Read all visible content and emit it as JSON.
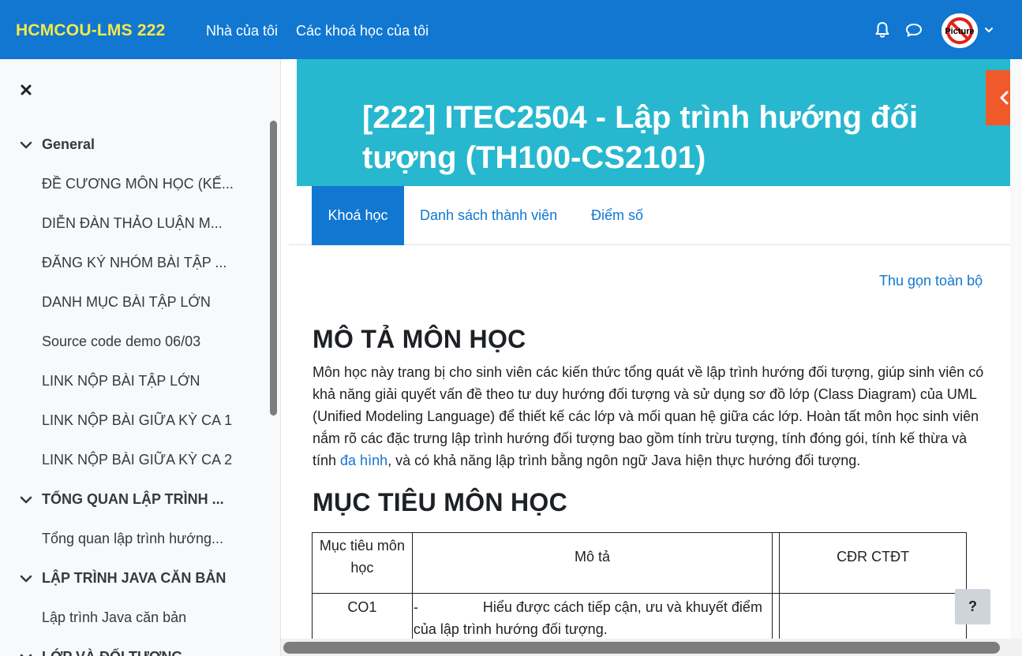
{
  "navbar": {
    "brand": "HCMCOU-LMS 222",
    "links": [
      "Nhà của tôi",
      "Các khoá học của tôi"
    ],
    "avatar_text": "Picture"
  },
  "drawer": {
    "sections": [
      {
        "title": "General",
        "items": [
          "ĐỀ CƯƠNG MÔN HỌC (KẾ...",
          "DIỄN ĐÀN THẢO LUẬN M...",
          "ĐĂNG KÝ NHÓM BÀI TẬP ...",
          "DANH MỤC BÀI TẬP LỚN",
          "Source code demo 06/03",
          "LINK NỘP BÀI TẬP LỚN",
          "LINK NỘP BÀI GIỮA KỲ CA 1",
          "LINK NỘP BÀI GIỮA KỲ CA 2"
        ]
      },
      {
        "title": "TỔNG QUAN LẬP TRÌNH ...",
        "items": [
          "Tổng quan lập trình hướng..."
        ]
      },
      {
        "title": "LẬP TRÌNH JAVA CĂN BẢN",
        "items": [
          "Lập trình Java căn bản"
        ]
      },
      {
        "title": "LỚP VÀ ĐỐI TƯỢNG",
        "items": []
      }
    ]
  },
  "course": {
    "title": "[222] ITEC2504 - Lập trình hướng đối tượng (TH100-CS2101)"
  },
  "tabs": [
    "Khoá học",
    "Danh sách thành viên",
    "Điểm số"
  ],
  "collapse_all": "Thu gọn toàn bộ",
  "description": {
    "heading": "MÔ TẢ MÔN HỌC",
    "text_before_link": "Môn học này trang bị cho sinh viên các kiến thức tổng quát về lập trình hướng đối tượng, giúp sinh viên có khả năng giải quyết vấn đề theo tư duy hướng đối tượng và sử dụng sơ đồ lớp (Class Diagram) của UML (Unified Modeling Language) để thiết kế các lớp và mối quan hệ giữa các lớp.  Hoàn tất môn học sinh viên nắm rõ các đặc trưng lập trình hướng đối tượng bao gồm tính trừu tượng, tính đóng gói, tính kế thừa và tính ",
    "link": "đa hình",
    "text_after_link": ", và có khả năng lập trình bằng ngôn ngữ Java hiện thực hướng đối tượng."
  },
  "goals": {
    "heading": "MỤC TIÊU MÔN HỌC",
    "table": {
      "headers": [
        "Mục tiêu môn học",
        "Mô tả",
        "",
        "CĐR CTĐT"
      ],
      "rows": [
        {
          "code": "CO1",
          "dash": "-",
          "desc": "Hiểu được cách tiếp cận, ưu và khuyết điểm của lập trình hướng đối tượng.",
          "extra": "",
          "outcome": ""
        }
      ]
    }
  },
  "help_button": "?"
}
